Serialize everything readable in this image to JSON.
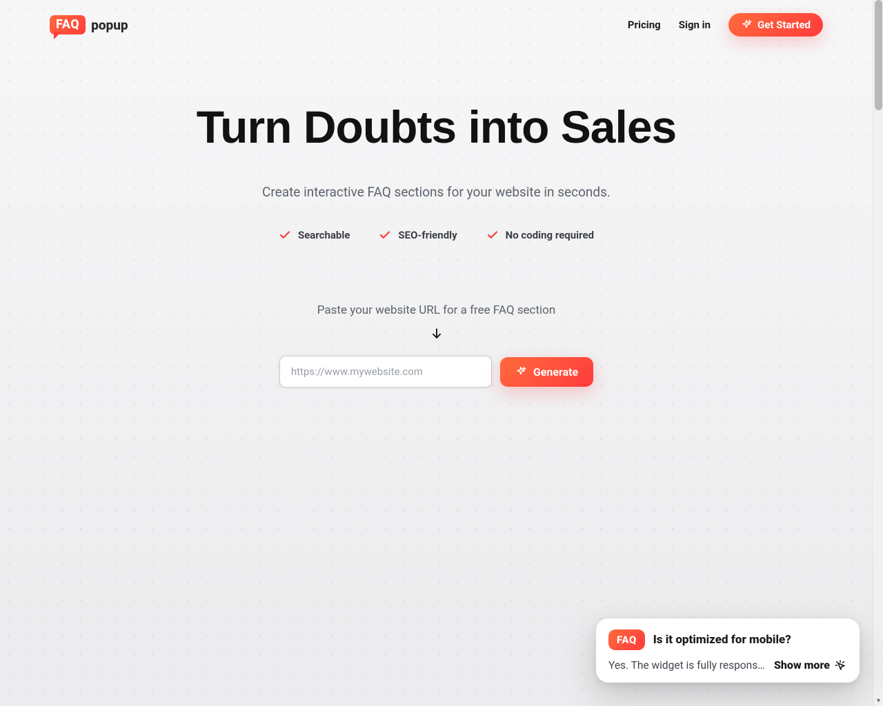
{
  "brand": {
    "badge": "FAQ",
    "suffix": "popup"
  },
  "nav": {
    "pricing": "Pricing",
    "signin": "Sign in",
    "cta": "Get Started"
  },
  "hero": {
    "headline": "Turn Doubts into Sales",
    "sub": "Create interactive FAQ sections for your website in seconds.",
    "features": [
      "Searchable",
      "SEO-friendly",
      "No coding required"
    ],
    "cta_hint": "Paste your website URL for a free FAQ section",
    "url_placeholder": "https://www.mywebsite.com",
    "generate": "Generate"
  },
  "popup": {
    "badge": "FAQ",
    "question": "Is it optimized for mobile?",
    "answer": "Yes. The widget is fully responsiv…",
    "show_more": "Show more"
  }
}
